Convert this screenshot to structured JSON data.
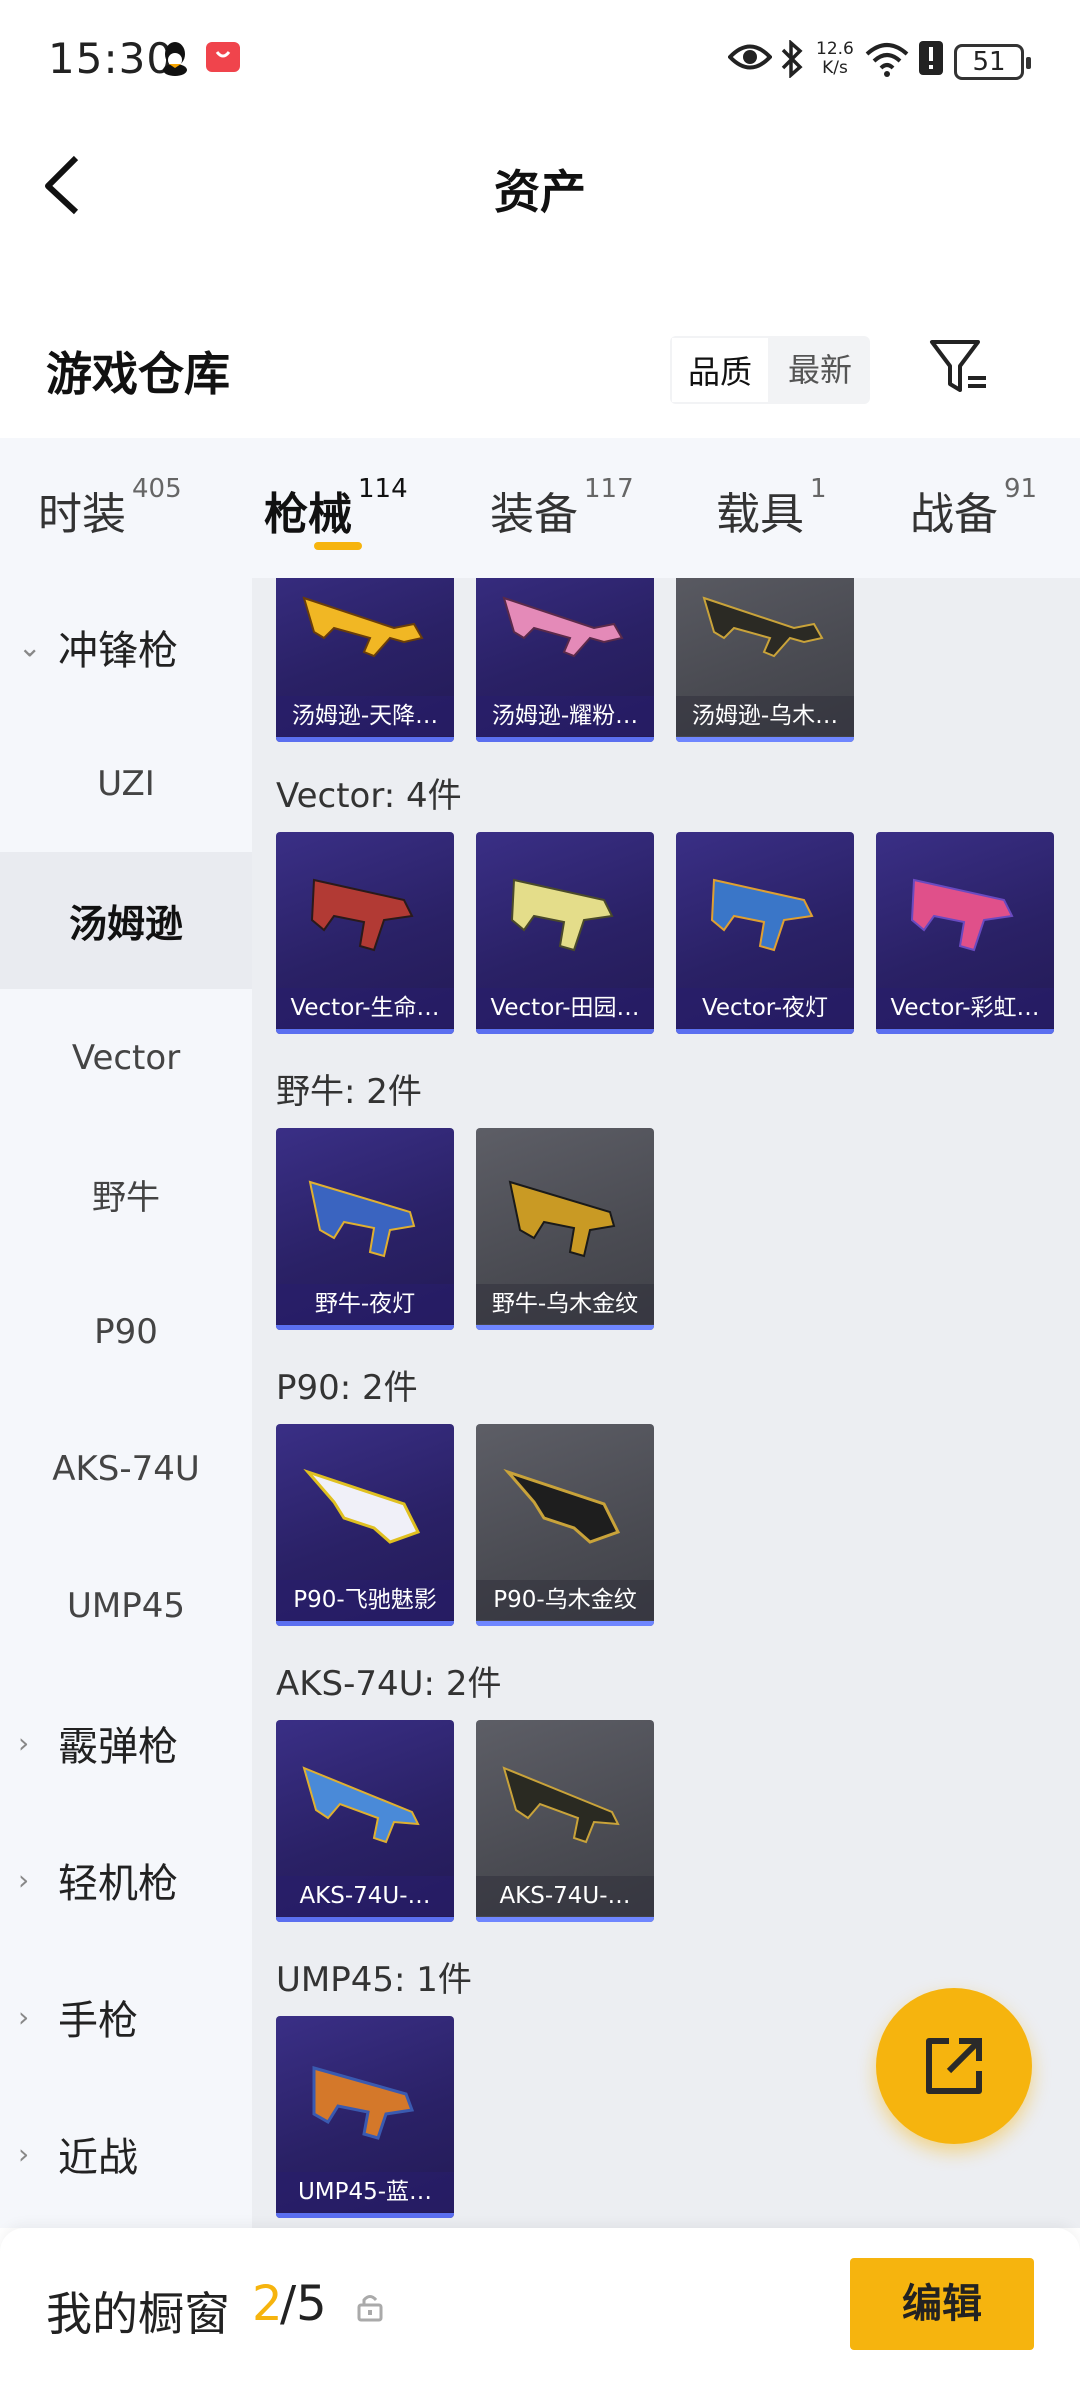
{
  "status": {
    "time": "15:30",
    "net_speed_value": "12.6",
    "net_speed_unit": "K/s",
    "battery": "51"
  },
  "header": {
    "title": "资产"
  },
  "warehouse": {
    "title": "游戏仓库",
    "sort_options": [
      "品质",
      "最新"
    ],
    "active_sort": "品质"
  },
  "tabs": [
    {
      "label": "时装",
      "count": "405"
    },
    {
      "label": "枪械",
      "count": "114",
      "active": true
    },
    {
      "label": "装备",
      "count": "117"
    },
    {
      "label": "载具",
      "count": "1"
    },
    {
      "label": "战备",
      "count": "91"
    }
  ],
  "sidebar": [
    {
      "label": "冲锋枪",
      "type": "group",
      "expanded": true
    },
    {
      "label": "UZI",
      "type": "item"
    },
    {
      "label": "汤姆逊",
      "type": "item",
      "selected": true
    },
    {
      "label": "Vector",
      "type": "item"
    },
    {
      "label": "野牛",
      "type": "item"
    },
    {
      "label": "P90",
      "type": "item"
    },
    {
      "label": "AKS-74U",
      "type": "item"
    },
    {
      "label": "UMP45",
      "type": "item"
    },
    {
      "label": "霰弹枪",
      "type": "group",
      "expanded": false
    },
    {
      "label": "轻机枪",
      "type": "group",
      "expanded": false
    },
    {
      "label": "手枪",
      "type": "group",
      "expanded": false
    },
    {
      "label": "近战",
      "type": "group",
      "expanded": false
    }
  ],
  "sections": [
    {
      "title": "",
      "items": [
        {
          "name": "汤姆逊-天降…",
          "rarity": "purple"
        },
        {
          "name": "汤姆逊-耀粉…",
          "rarity": "purple"
        },
        {
          "name": "汤姆逊-乌木…",
          "rarity": "gray"
        }
      ]
    },
    {
      "title": "Vector: 4件",
      "items": [
        {
          "name": "Vector-生命…",
          "rarity": "purple"
        },
        {
          "name": "Vector-田园…",
          "rarity": "purple"
        },
        {
          "name": "Vector-夜灯",
          "rarity": "purple"
        },
        {
          "name": "Vector-彩虹…",
          "rarity": "purple"
        }
      ]
    },
    {
      "title": "野牛: 2件",
      "items": [
        {
          "name": "野牛-夜灯",
          "rarity": "purple"
        },
        {
          "name": "野牛-乌木金纹",
          "rarity": "gray"
        }
      ]
    },
    {
      "title": "P90: 2件",
      "items": [
        {
          "name": "P90-飞驰魅影",
          "rarity": "purple"
        },
        {
          "name": "P90-乌木金纹",
          "rarity": "gray"
        }
      ]
    },
    {
      "title": "AKS-74U: 2件",
      "items": [
        {
          "name": "AKS-74U-…",
          "rarity": "purple"
        },
        {
          "name": "AKS-74U-…",
          "rarity": "gray"
        }
      ]
    },
    {
      "title": "UMP45: 1件",
      "items": [
        {
          "name": "UMP45-蓝…",
          "rarity": "purple"
        }
      ]
    }
  ],
  "footer": {
    "label": "我的橱窗",
    "current": "2",
    "total": "/5",
    "edit_label": "编辑"
  },
  "colors": {
    "accent": "#f6b40e",
    "card_purple": "#2a2166",
    "card_gray": "#4a4b52"
  }
}
